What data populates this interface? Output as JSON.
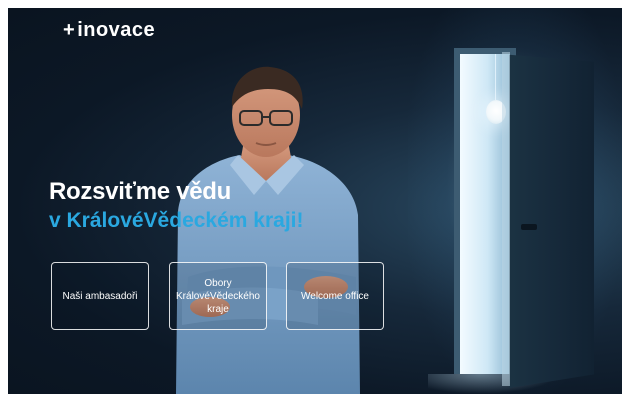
{
  "header": {
    "logo_plus": "+",
    "logo_text": "inovace"
  },
  "hero": {
    "headline_line1": "Rozsviťme vědu",
    "headline_line2": "v KrálovéVědeckém kraji!"
  },
  "buttons": [
    {
      "label": "Naši ambasadoři"
    },
    {
      "label": "Obory KrálovéVědeckého kraje"
    },
    {
      "label": "Welcome office"
    }
  ],
  "colors": {
    "accent": "#2aa8e0",
    "background": "#0c1826"
  }
}
